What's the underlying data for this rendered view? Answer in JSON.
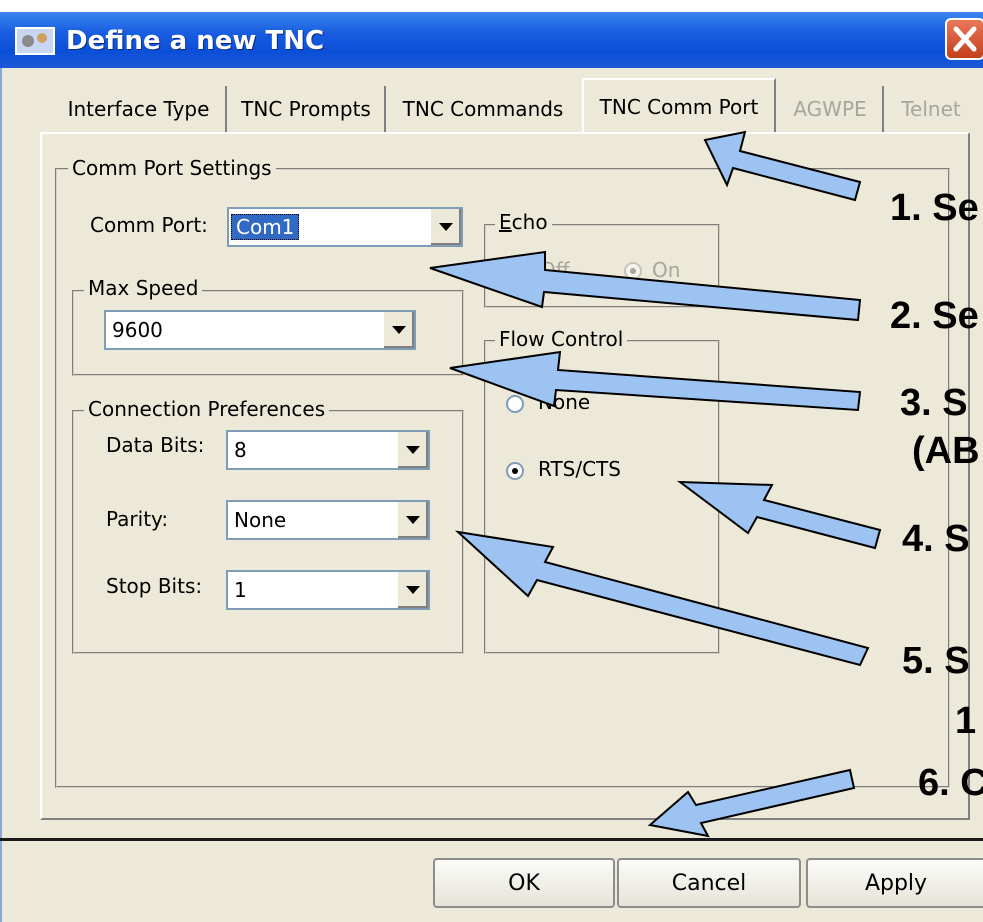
{
  "window": {
    "title": "Define a new TNC"
  },
  "tabs": [
    {
      "label": "Interface Type",
      "state": "normal"
    },
    {
      "label": "TNC Prompts",
      "state": "normal"
    },
    {
      "label": "TNC Commands",
      "state": "normal"
    },
    {
      "label": "TNC Comm Port",
      "state": "active"
    },
    {
      "label": "AGWPE",
      "state": "disabled"
    },
    {
      "label": "Telnet",
      "state": "disabled"
    }
  ],
  "comm_port_settings": {
    "group_label": "Comm Port Settings",
    "comm_port_label": "Comm Port:",
    "comm_port_value": "Com1",
    "max_speed": {
      "group_label": "Max Speed",
      "value": "9600"
    },
    "connection_preferences": {
      "group_label": "Connection Preferences",
      "data_bits_label": "Data Bits:",
      "data_bits_value": "8",
      "parity_label": "Parity:",
      "parity_value": "None",
      "stop_bits_label": "Stop Bits:",
      "stop_bits_value": "1"
    },
    "echo": {
      "group_label": "Echo",
      "off_label": "Off",
      "on_label": "On",
      "selected": "On",
      "enabled": false
    },
    "flow_control": {
      "group_label": "Flow Control",
      "none_label": "None",
      "rts_label": "RTS/CTS",
      "selected": "RTS/CTS"
    }
  },
  "buttons": {
    "ok": "OK",
    "cancel": "Cancel",
    "apply": "Apply"
  },
  "annotations": {
    "a1": "1. Se",
    "a2": "2. Se",
    "a3": "3. S",
    "a3b": "(AB",
    "a4": "4. S",
    "a5": "5. S",
    "a5b": "1",
    "a6": "6. C"
  },
  "colors": {
    "arrow": "#9cc3f2",
    "titlebar": "#0b4fd8",
    "dialog_bg": "#ece9d8"
  }
}
